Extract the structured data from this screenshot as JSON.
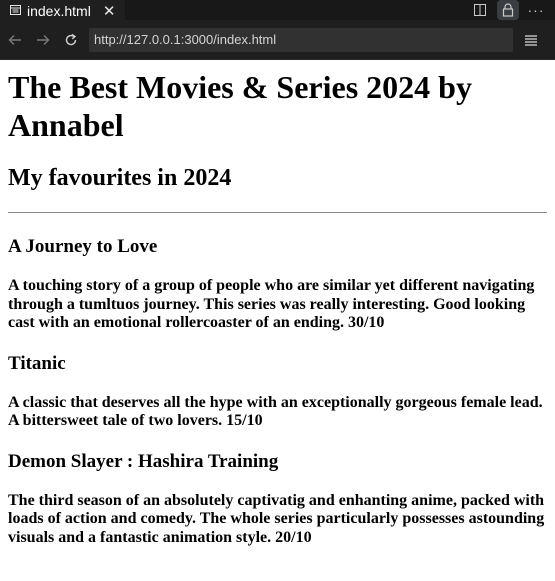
{
  "browser": {
    "tab_title": "index.html",
    "url": "http://127.0.0.1:3000/index.html"
  },
  "page": {
    "title": "The Best Movies & Series 2024 by Annabel",
    "subtitle": "My favourites in 2024",
    "entries": [
      {
        "name": "A Journey to Love",
        "description": "A touching story of a group of people who are similar yet different navigating through a tumltuos journey. This series was really interesting. Good looking cast with an emotional rollercoaster of an ending. 30/10"
      },
      {
        "name": "Titanic",
        "description": "A classic that deserves all the hype with an exceptionally gorgeous female lead. A bittersweet tale of two lovers. 15/10"
      },
      {
        "name": "Demon Slayer : Hashira Training",
        "description": "The third season of an absolutely captivatig and enhanting anime, packed with loads of action and comedy. The whole series particularly possesses astounding visuals and a fantastic animation style. 20/10"
      }
    ]
  }
}
